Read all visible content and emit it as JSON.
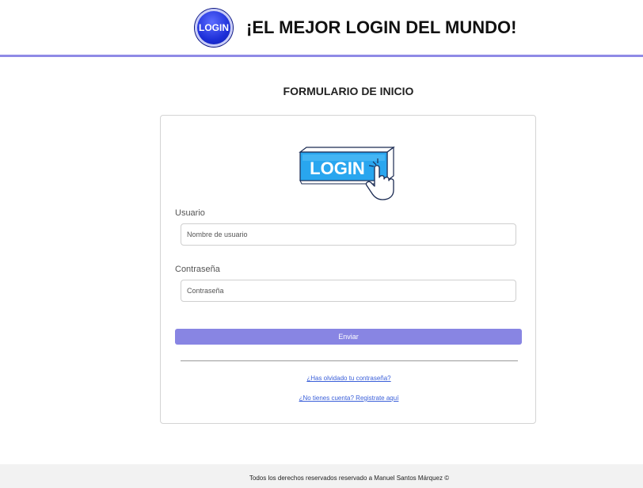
{
  "header": {
    "logo_text": "LOGIN",
    "title": "¡EL MEJOR LOGIN DEL MUNDO!"
  },
  "form": {
    "heading": "FORMULARIO DE INICIO",
    "illustration_text": "LOGIN",
    "username": {
      "label": "Usuario",
      "placeholder": "Nombre de usuario",
      "value": ""
    },
    "password": {
      "label": "Contraseña",
      "placeholder": "Contraseña",
      "value": ""
    },
    "submit_label": "Enviar",
    "forgot_link": "¿Has olvidado tu contraseña?",
    "register_link": "¿No tienes cuenta? Registrate aquí"
  },
  "footer": {
    "text": "Todos los derechos reservados reservado a Manuel Santos Márquez ©"
  },
  "colors": {
    "accent": "#8885e3",
    "header_border": "#8f8ae6",
    "logo_blue": "#1d2fd8",
    "link": "#3a5fd9",
    "illustration_blue": "#29a6ef",
    "footer_bg": "#f2f2f2"
  }
}
